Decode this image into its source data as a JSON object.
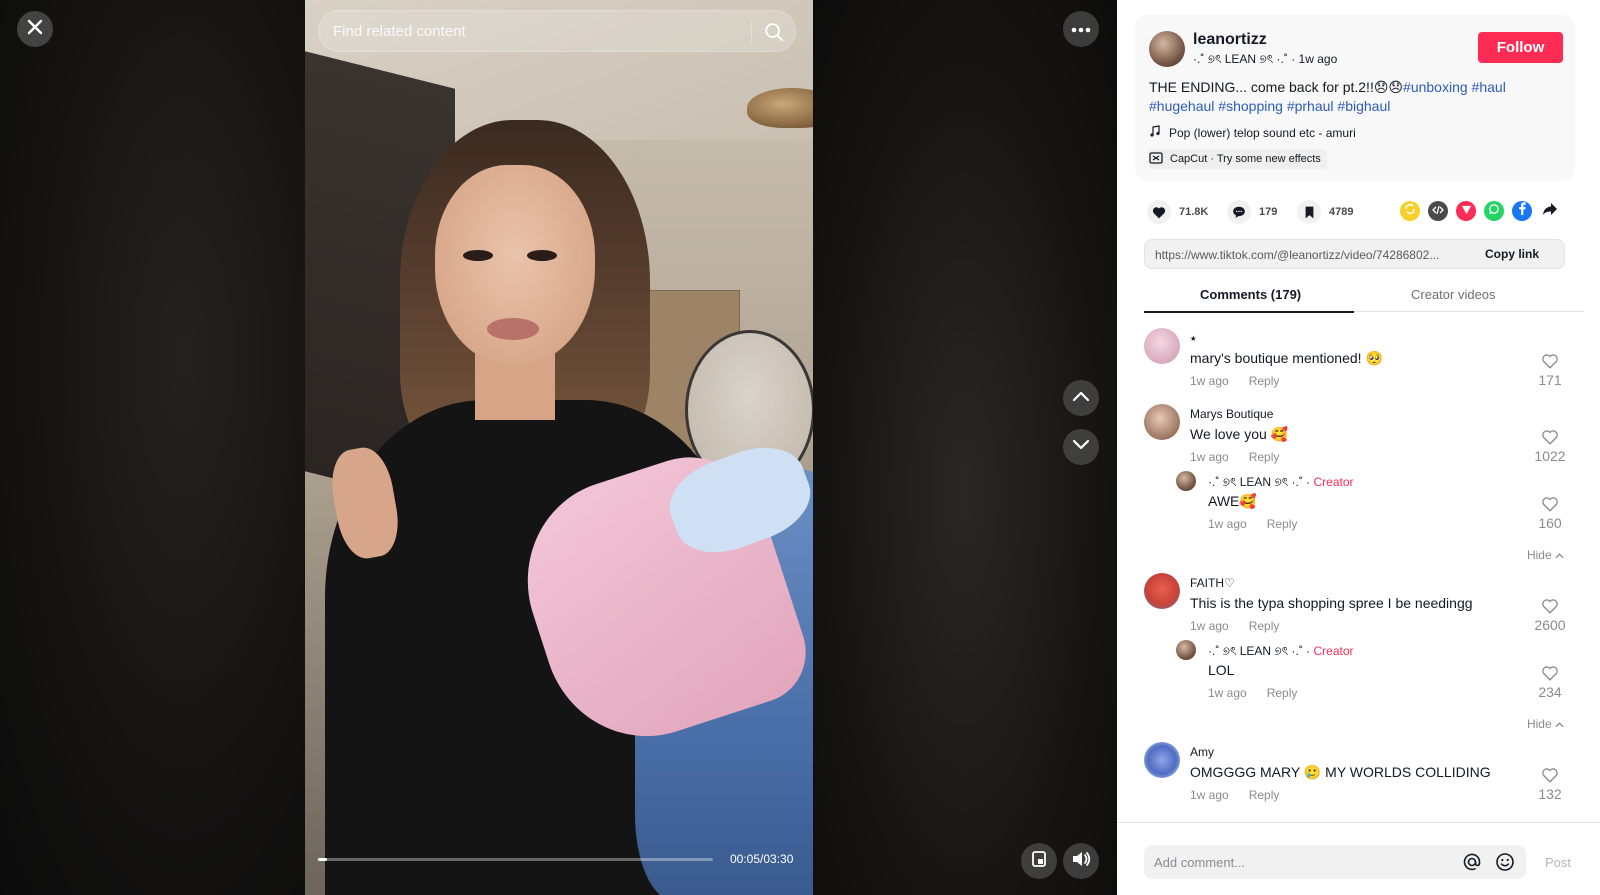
{
  "search": {
    "placeholder": "Find related content"
  },
  "video": {
    "current_time": "00:05",
    "duration": "03:30",
    "time_display": "00:05/03:30",
    "progress_fraction": 0.024
  },
  "post": {
    "username": "leanortizz",
    "display_name": "·.˚ ୭ৎ LEAN ୭ৎ ·.˚",
    "posted": "1w ago",
    "follow_label": "Follow",
    "caption_text": "THE ENDING... come back for pt.2!!😞😞",
    "hashtags": [
      "#unboxing",
      "#haul",
      "#hugehaul",
      "#shopping",
      "#prhaul",
      "#bighaul"
    ],
    "music": "Pop (lower) telop sound etc - amuri",
    "capcut": "CapCut · Try some new effects",
    "likes": "71.8K",
    "comments": "179",
    "saves": "4789",
    "link": "https://www.tiktok.com/@leanortizz/video/74286802...",
    "copy_label": "Copy link"
  },
  "tabs": [
    "Comments (179)",
    "Creator videos"
  ],
  "comments": [
    {
      "name": "⭑",
      "text": "mary's boutique mentioned! 🥺",
      "time": "1w ago",
      "reply": "Reply",
      "likes": "171"
    },
    {
      "name": "Marys Boutique",
      "text": "We love you 🥰",
      "time": "1w ago",
      "reply": "Reply",
      "likes": "1022"
    },
    {
      "name": "·.˚ ୭ৎ LEAN ୭ৎ ·.˚ · ",
      "badge": "Creator",
      "text": "AWE🥰",
      "time": "1w ago",
      "reply": "Reply",
      "likes": "160"
    },
    {
      "name": "FAITH♡",
      "text": "This is the typa shopping spree I be needingg",
      "time": "1w ago",
      "reply": "Reply",
      "likes": "2600"
    },
    {
      "name": "·.˚ ୭ৎ LEAN ୭ৎ ·.˚ · ",
      "badge": "Creator",
      "text": "LOL",
      "time": "1w ago",
      "reply": "Reply",
      "likes": "234"
    },
    {
      "name": "Amy",
      "text": "OMGGGG MARY 🥲 MY WORLDS COLLIDING",
      "time": "1w ago",
      "reply": "Reply",
      "likes": "132"
    }
  ],
  "hide_label": "Hide",
  "footer": {
    "placeholder": "Add comment...",
    "post_label": "Post"
  },
  "colors": {
    "accent": "#fe2c55",
    "hashtag": "#2b5db9"
  }
}
